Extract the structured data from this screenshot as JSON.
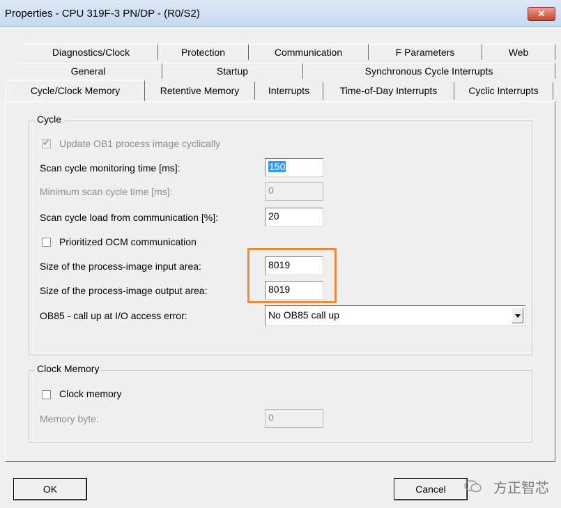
{
  "window": {
    "title": "Properties - CPU 319F-3 PN/DP - (R0/S2)",
    "close_icon": "close-icon"
  },
  "tabs": {
    "row1": [
      "Diagnostics/Clock",
      "Protection",
      "Communication",
      "F Parameters",
      "Web"
    ],
    "row2": [
      "General",
      "Startup",
      "Synchronous Cycle Interrupts"
    ],
    "row3": [
      "Cycle/Clock Memory",
      "Retentive Memory",
      "Interrupts",
      "Time-of-Day Interrupts",
      "Cyclic Interrupts"
    ],
    "selected": "Cycle/Clock Memory"
  },
  "cycle": {
    "title": "Cycle",
    "update_ob1_label": "Update OB1 process image cyclically",
    "update_ob1_checked": true,
    "scan_cycle_monitoring_label": "Scan cycle monitoring time [ms]:",
    "scan_cycle_monitoring_value": "150",
    "min_scan_cycle_label": "Minimum scan cycle time [ms]:",
    "min_scan_cycle_value": "0",
    "scan_cycle_load_label": "Scan cycle load from communication [%]:",
    "scan_cycle_load_value": "20",
    "prioritized_ocm_label": "Prioritized OCM communication",
    "prioritized_ocm_checked": false,
    "pi_input_label": "Size of the process-image input area:",
    "pi_input_value": "8019",
    "pi_output_label": "Size of the process-image output area:",
    "pi_output_value": "8019",
    "ob85_label": "OB85 - call up at I/O access error:",
    "ob85_value": "No OB85 call up"
  },
  "clock_memory": {
    "title": "Clock Memory",
    "clock_memory_label": "Clock memory",
    "clock_memory_checked": false,
    "memory_byte_label": "Memory byte:",
    "memory_byte_value": "0"
  },
  "buttons": {
    "ok": "OK",
    "cancel": "Cancel"
  },
  "watermark": "方正智芯",
  "colors": {
    "highlight": "#ef8a3a",
    "selection": "#3399ff"
  }
}
